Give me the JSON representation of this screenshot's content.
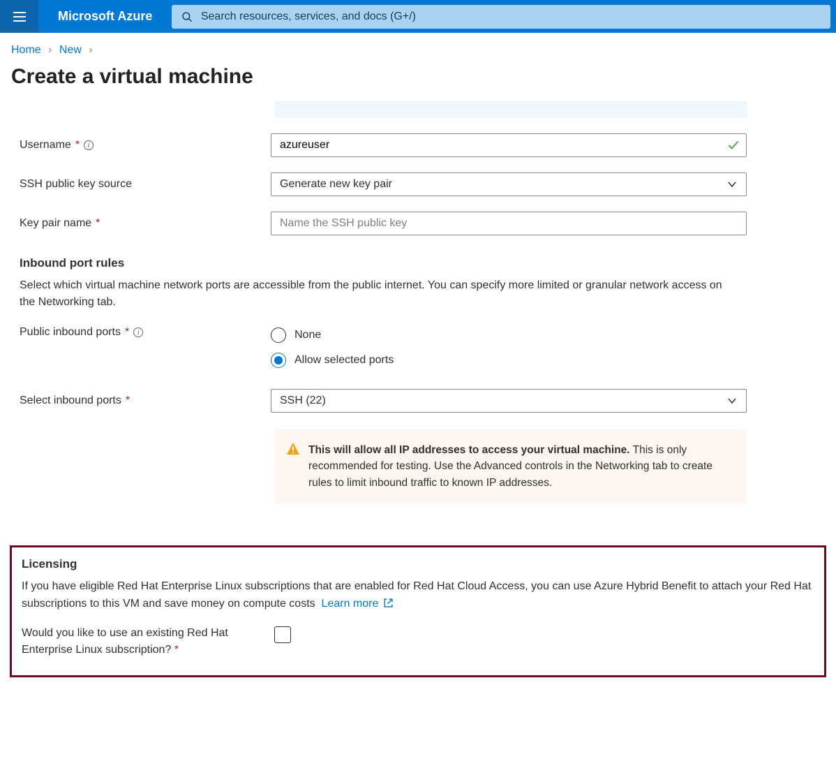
{
  "header": {
    "brand": "Microsoft Azure",
    "search_placeholder": "Search resources, services, and docs (G+/)"
  },
  "breadcrumb": {
    "home": "Home",
    "new": "New"
  },
  "page_title": "Create a virtual machine",
  "fields": {
    "username_label": "Username",
    "username_value": "azureuser",
    "ssh_source_label": "SSH public key source",
    "ssh_source_value": "Generate new key pair",
    "keypair_label": "Key pair name",
    "keypair_placeholder": "Name the SSH public key"
  },
  "inbound": {
    "heading": "Inbound port rules",
    "desc": "Select which virtual machine network ports are accessible from the public internet. You can specify more limited or granular network access on the Networking tab.",
    "public_label": "Public inbound ports",
    "radio_none": "None",
    "radio_allow": "Allow selected ports",
    "select_label": "Select inbound ports",
    "select_value": "SSH (22)",
    "warn_strong": "This will allow all IP addresses to access your virtual machine.",
    "warn_rest": "  This is only recommended for testing.  Use the Advanced controls in the Networking tab to create rules to limit inbound traffic to known IP addresses."
  },
  "licensing": {
    "heading": "Licensing",
    "desc": "If you have eligible Red Hat Enterprise Linux subscriptions that are enabled for Red Hat Cloud Access, you can use Azure Hybrid Benefit to attach your Red Hat subscriptions to this VM and save money on compute costs",
    "learn_more": "Learn more",
    "checkbox_label": "Would you like to use an existing Red Hat Enterprise Linux subscription?"
  }
}
